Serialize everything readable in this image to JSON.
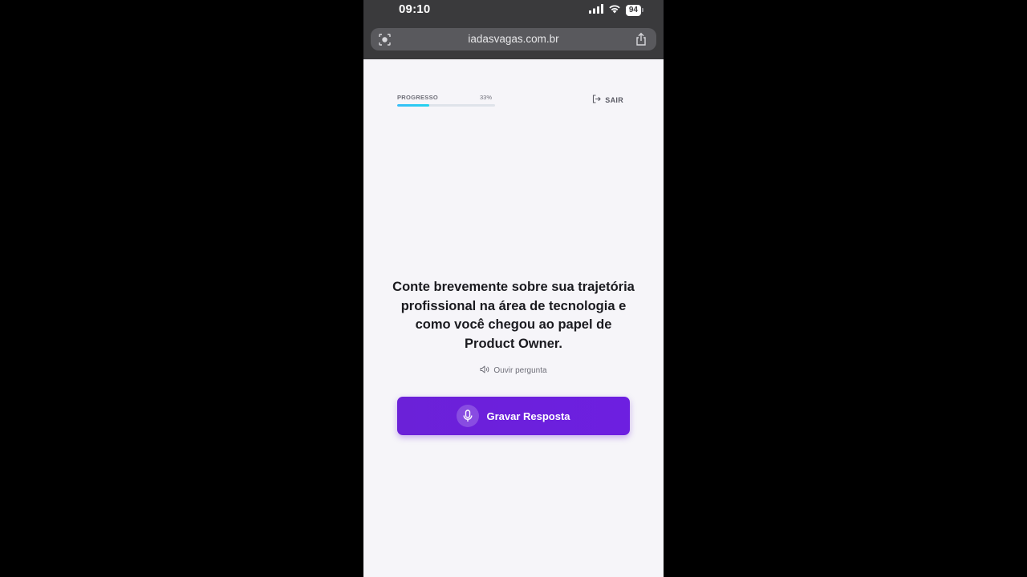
{
  "status_bar": {
    "time": "09:10",
    "battery": "94",
    "signal_icon": "signal-bars-icon",
    "wifi_icon": "wifi-icon"
  },
  "browser": {
    "url": "iadasvagas.com.br",
    "left_icon": "page-settings-icon",
    "share_icon": "share-icon"
  },
  "progress": {
    "label": "PROGRESSO",
    "value_text": "33%",
    "fraction": 0.33,
    "fill_color": "#22d3ee"
  },
  "exit": {
    "label": "SAIR",
    "icon": "logout-icon"
  },
  "question": {
    "text": "Conte brevemente sobre sua trajetória profissional na área de tecnologia e como você chegou ao papel de Product Owner."
  },
  "listen": {
    "label": "Ouvir pergunta",
    "icon": "speaker-icon"
  },
  "record_button": {
    "label": "Gravar Resposta",
    "icon": "microphone-icon",
    "color": "#6b21d8"
  }
}
